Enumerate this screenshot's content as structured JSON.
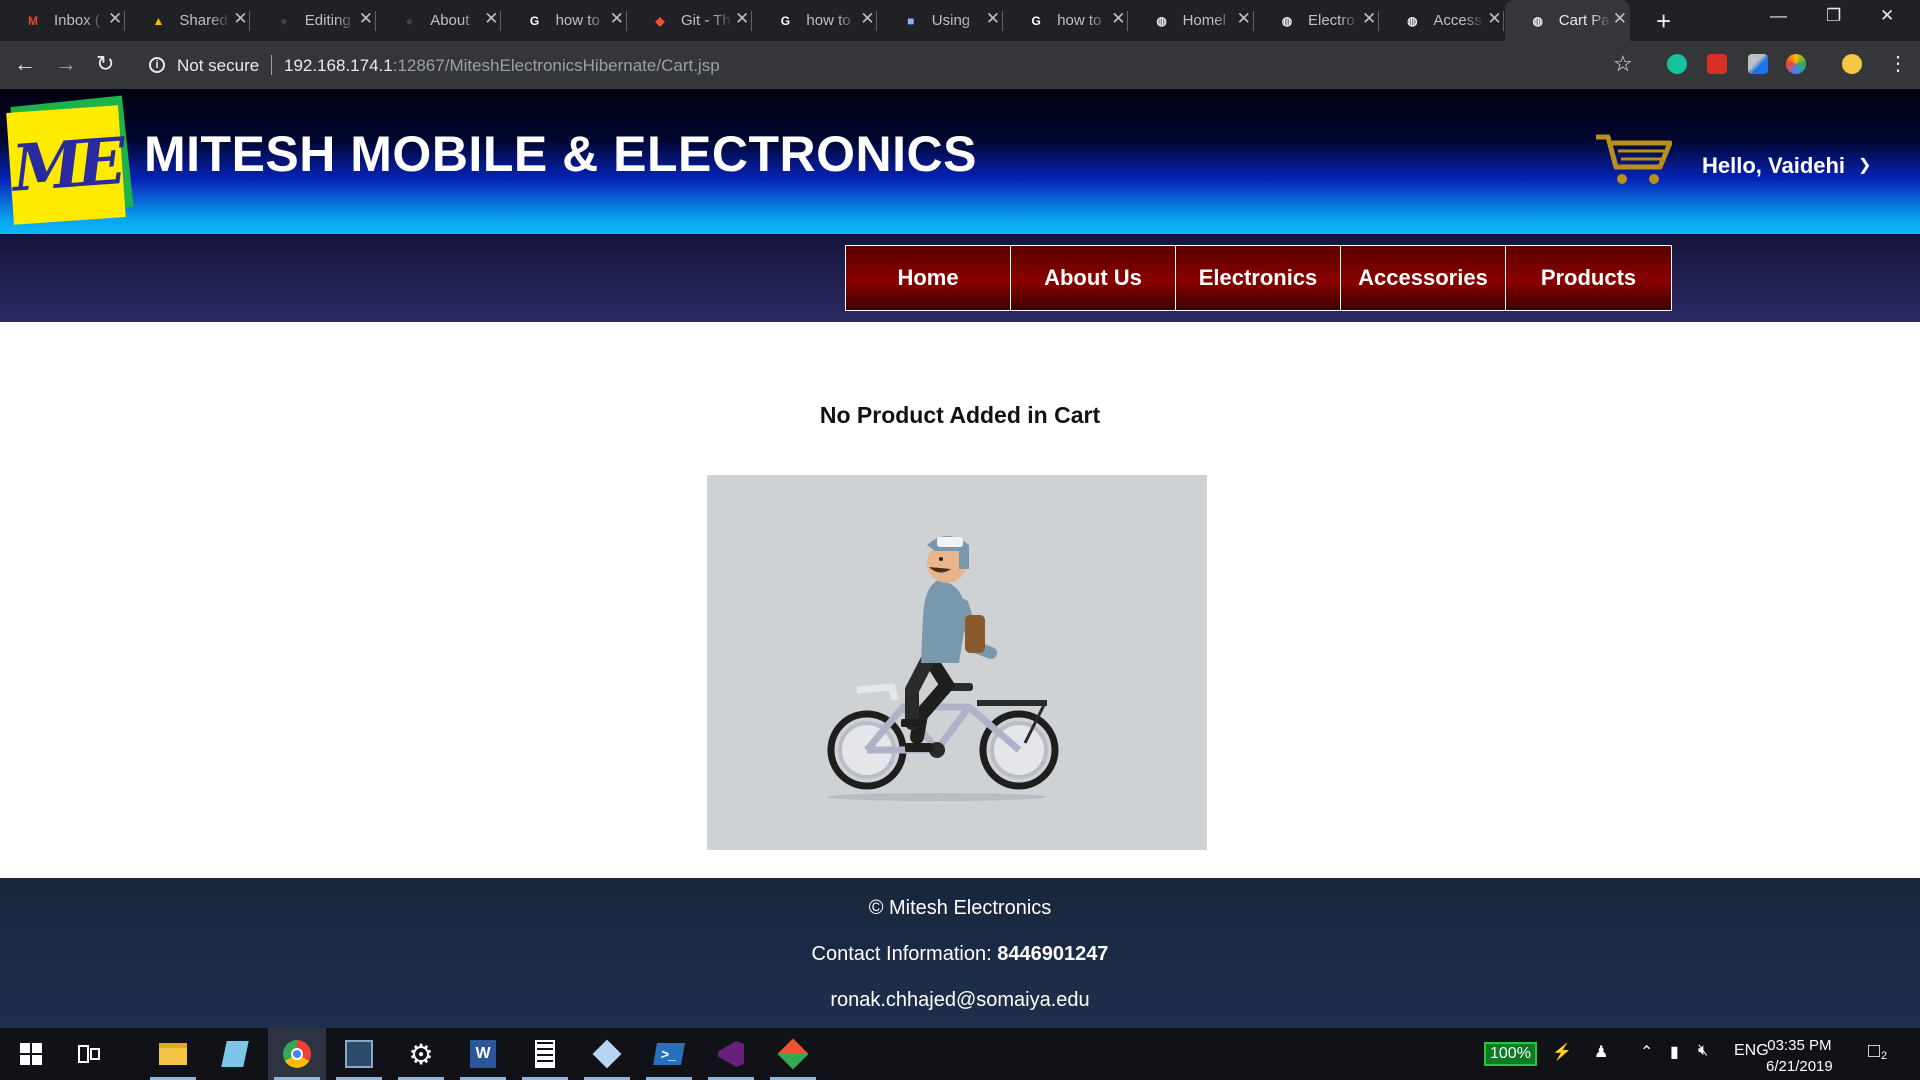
{
  "browser": {
    "tabs": [
      {
        "title": "Inbox (",
        "favicon": "gmail-icon",
        "color": "#ea4335",
        "glyph": "M"
      },
      {
        "title": "Shared",
        "favicon": "drive-icon",
        "color": "#fbbc04",
        "glyph": "▲"
      },
      {
        "title": "Editing",
        "favicon": "github-icon",
        "color": "#444444",
        "glyph": "●"
      },
      {
        "title": "About",
        "favicon": "github-icon",
        "color": "#444444",
        "glyph": "●"
      },
      {
        "title": "how to",
        "favicon": "google-icon",
        "color": "#ffffff",
        "glyph": "G"
      },
      {
        "title": "Git - Th",
        "favicon": "git-icon",
        "color": "#f05033",
        "glyph": "◆"
      },
      {
        "title": "how to",
        "favicon": "google-icon",
        "color": "#ffffff",
        "glyph": "G"
      },
      {
        "title": "Using",
        "favicon": "cube-icon",
        "color": "#8ab4f8",
        "glyph": "■"
      },
      {
        "title": "how to",
        "favicon": "google-icon",
        "color": "#ffffff",
        "glyph": "G"
      },
      {
        "title": "Homel",
        "favicon": "globe-icon",
        "color": "#e8eaed",
        "glyph": "◍"
      },
      {
        "title": "Electro",
        "favicon": "globe-icon",
        "color": "#e8eaed",
        "glyph": "◍"
      },
      {
        "title": "Access",
        "favicon": "globe-icon",
        "color": "#e8eaed",
        "glyph": "◍"
      },
      {
        "title": "Cart Pa",
        "favicon": "globe-icon",
        "color": "#e8eaed",
        "glyph": "◍"
      }
    ],
    "active_tab": 12,
    "security_label": "Not secure",
    "url_host": "192.168.174.1",
    "url_rest": ":12867/MiteshElectronicsHibernate/Cart.jsp"
  },
  "site": {
    "logo_text": "ME",
    "title": "MITESH MOBILE & ELECTRONICS",
    "greeting": "Hello, Vaidehi",
    "nav": [
      "Home",
      "About Us",
      "Electronics",
      "Accessories",
      "Products"
    ]
  },
  "cart": {
    "empty_message": "No Product Added in Cart"
  },
  "footer": {
    "copyright": "© Mitesh Electronics",
    "contact_label": "Contact Information:",
    "contact_number": "8446901247",
    "email": "ronak.chhajed@somaiya.edu"
  },
  "taskbar": {
    "battery": "100%",
    "language": "ENG",
    "time": "03:35 PM",
    "date": "6/21/2019",
    "notifications": "2"
  }
}
